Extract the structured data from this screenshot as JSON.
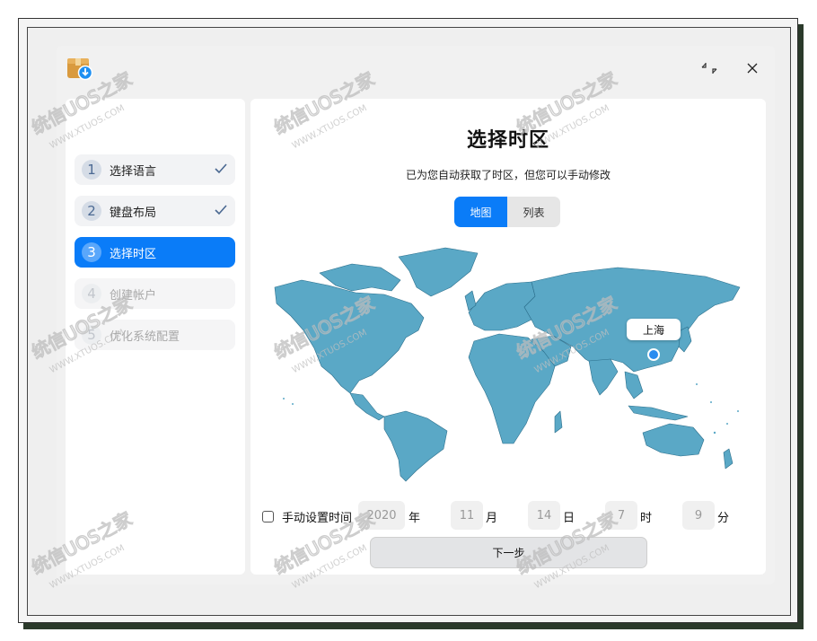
{
  "window": {
    "app_icon": "installer-package-icon",
    "minimize_icon": "collapse-icon",
    "close_icon": "close-icon"
  },
  "sidebar": {
    "steps": [
      {
        "num": "1",
        "label": "选择语言",
        "state": "done"
      },
      {
        "num": "2",
        "label": "键盘布局",
        "state": "done"
      },
      {
        "num": "3",
        "label": "选择时区",
        "state": "active"
      },
      {
        "num": "4",
        "label": "创建帐户",
        "state": "pending"
      },
      {
        "num": "5",
        "label": "优化系统配置",
        "state": "pending"
      }
    ]
  },
  "main": {
    "title": "选择时区",
    "subtitle": "已为您自动获取了时区，但您可以手动修改",
    "tabs": {
      "map": "地图",
      "list": "列表",
      "selected": "map"
    },
    "map_pin_label": "上海",
    "manual": {
      "label": "手动设置时间",
      "checked": false,
      "year": "2020",
      "year_unit": "年",
      "month": "11",
      "month_unit": "月",
      "day": "14",
      "day_unit": "日",
      "hour": "7",
      "hour_unit": "时",
      "minute": "9",
      "minute_unit": "分"
    },
    "next_label": "下一步"
  },
  "watermark": {
    "text1": "统信UOS之家",
    "text2": "WWW.XTUOS.COM"
  },
  "colors": {
    "accent": "#0a7cf8",
    "map_land": "#5aa8c6",
    "map_border": "#2c6f8c"
  }
}
